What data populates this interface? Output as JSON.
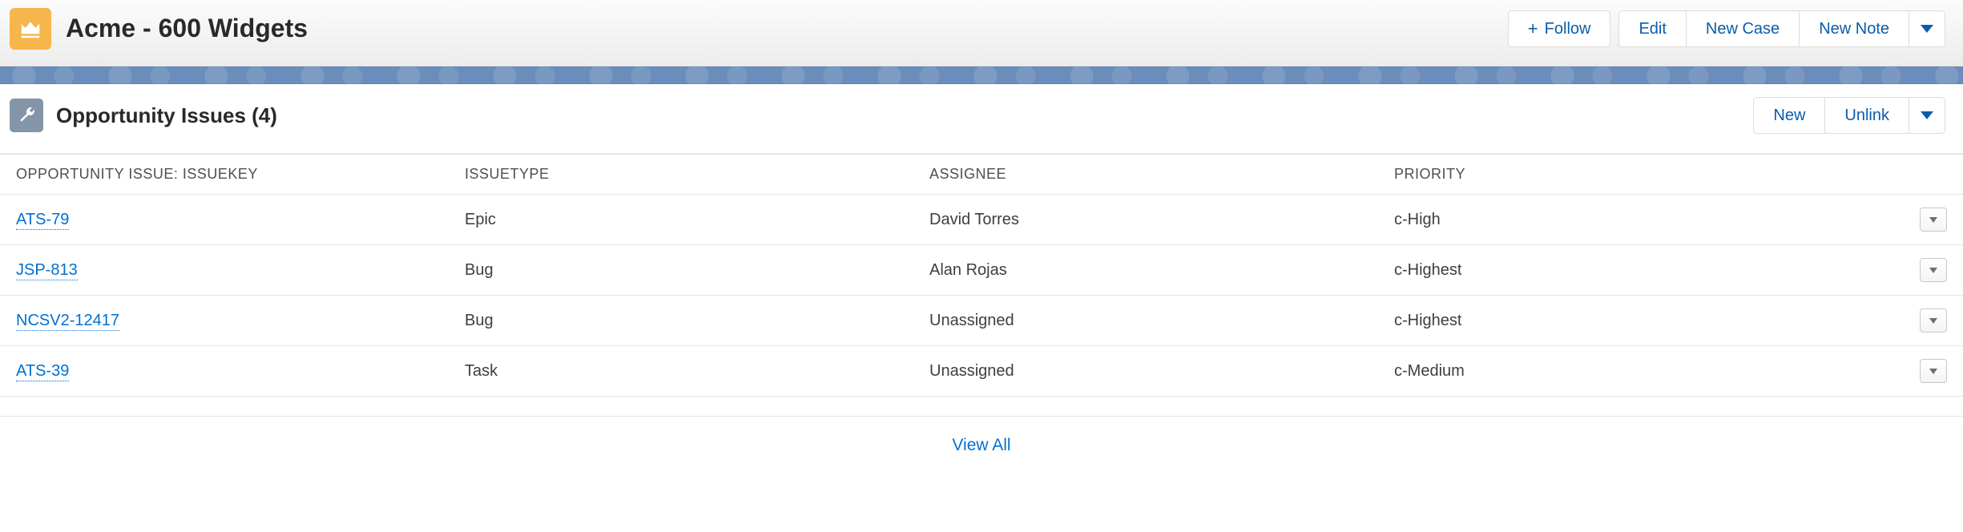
{
  "header": {
    "title": "Acme - 600 Widgets",
    "actions": {
      "follow": "Follow",
      "edit": "Edit",
      "new_case": "New Case",
      "new_note": "New Note"
    }
  },
  "panel": {
    "title": "Opportunity Issues (4)",
    "actions": {
      "new": "New",
      "unlink": "Unlink"
    }
  },
  "table": {
    "columns": {
      "issue_key": "OPPORTUNITY ISSUE: ISSUEKEY",
      "issue_type": "ISSUETYPE",
      "assignee": "ASSIGNEE",
      "priority": "PRIORITY"
    },
    "rows": [
      {
        "key": "ATS-79",
        "type": "Epic",
        "assignee": "David Torres",
        "priority": "c-High"
      },
      {
        "key": "JSP-813",
        "type": "Bug",
        "assignee": "Alan Rojas",
        "priority": "c-Highest"
      },
      {
        "key": "NCSV2-12417",
        "type": "Bug",
        "assignee": "Unassigned",
        "priority": "c-Highest"
      },
      {
        "key": "ATS-39",
        "type": "Task",
        "assignee": "Unassigned",
        "priority": "c-Medium"
      }
    ]
  },
  "footer": {
    "view_all": "View All"
  }
}
